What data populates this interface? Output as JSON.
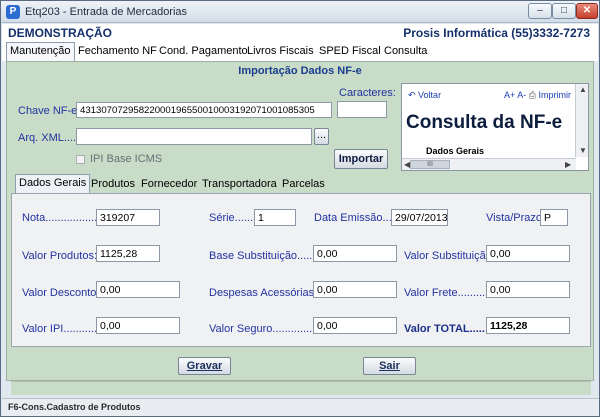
{
  "window": {
    "title": "Etq203 - Entrada de Mercadorias",
    "app_icon": "P"
  },
  "header": {
    "left": "DEMONSTRAÇÃO",
    "right": "Prosis Informática (55)3332-7273"
  },
  "main_tabs": [
    "Manutenção",
    "Fechamento NF",
    "Cond. Pagamento",
    "Livros Fiscais",
    "SPED Fiscal",
    "Consulta"
  ],
  "import": {
    "title": "Importação Dados NF-e",
    "chave_label": "Chave NF-e:",
    "chave_value": "43130707295822000196550010003192071001085305",
    "caracteres_label": "Caracteres:",
    "caracteres_value": "",
    "xml_label": "Arq. XML......:",
    "xml_value": "",
    "browse_label": "...",
    "ipi_label": "IPI Base ICMS",
    "import_button": "Importar"
  },
  "browser": {
    "back": "Voltar",
    "font_up": "A+",
    "font_down": "A-",
    "print": "Imprimir",
    "title": "Consulta da NF-e",
    "subtitle": "Dados Gerais",
    "hscroll_grip": "III"
  },
  "sub_tabs": [
    "Dados Gerais",
    "Produtos",
    "Fornecedor",
    "Transportadora",
    "Parcelas"
  ],
  "fields": {
    "nota_label": "Nota.....................",
    "nota_value": "319207",
    "serie_label": "Série.......:",
    "serie_value": "1",
    "data_emissao_label": "Data Emissão.....:",
    "data_emissao_value": "29/07/2013",
    "vista_prazo_label": "Vista/Prazo:",
    "vista_prazo_value": "P",
    "valor_produtos_label": "Valor Produtos:",
    "valor_produtos_value": "1125,28",
    "base_subst_label": "Base Substituição.........:",
    "base_subst_value": "0,00",
    "valor_subst_label": "Valor Substituição:",
    "valor_subst_value": "0,00",
    "valor_desconto_label": "Valor Desconto:",
    "valor_desconto_value": "0,00",
    "despesas_label": "Despesas Acessórias:",
    "despesas_value": "0,00",
    "valor_frete_label": "Valor Frete............:",
    "valor_frete_value": "0,00",
    "valor_ipi_label": "Valor IPI...............:",
    "valor_ipi_value": "0,00",
    "valor_seguro_label": "Valor Seguro...................:",
    "valor_seguro_value": "0,00",
    "valor_total_label": "Valor TOTAL.....:",
    "valor_total_value": "1125,28"
  },
  "buttons": {
    "gravar": "Gravar",
    "sair": "Sair"
  },
  "status": "F6-Cons.Cadastro de Produtos",
  "colors": {
    "panel_green": "#c9dcc7",
    "label_blue": "#2233a0",
    "header_navy": "#14306b"
  }
}
